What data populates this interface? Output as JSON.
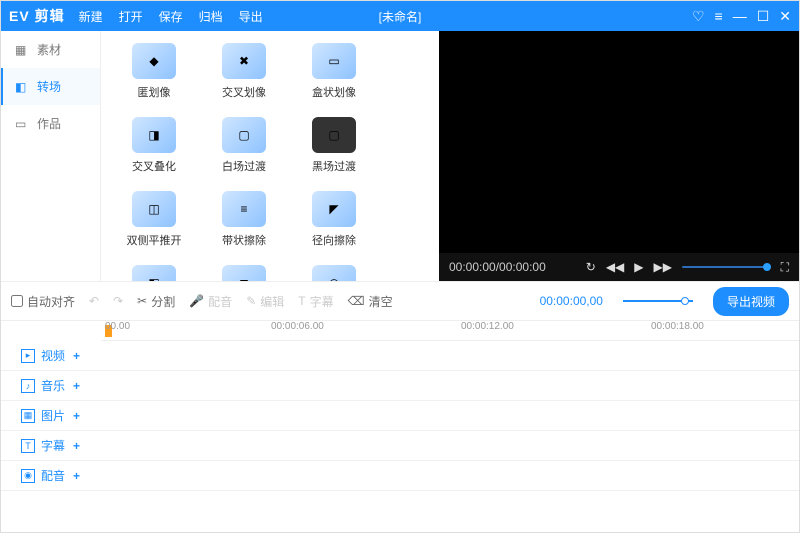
{
  "brand": "EV 剪辑",
  "menu": [
    "新建",
    "打开",
    "保存",
    "归档",
    "导出"
  ],
  "titleName": "[未命名]",
  "side": {
    "items": [
      "素材",
      "转场",
      "作品"
    ],
    "activeIndex": 1
  },
  "transitions": [
    "匿划像",
    "交叉划像",
    "盒状划像",
    "交叉叠化",
    "白场过渡",
    "黑场过渡",
    "双侧平推开",
    "带状擦除",
    "径向擦除",
    "",
    "",
    ""
  ],
  "preview": {
    "time": "00:00:00/00:00:00"
  },
  "toolbar": {
    "align": "自动对齐",
    "split": "分割",
    "dub": "配音",
    "edit": "编辑",
    "caption": "字幕",
    "clear": "清空",
    "timecode": "00:00:00,00",
    "export": "导出视频"
  },
  "ruler": [
    "00.00",
    "00:00:06.00",
    "00:00:12.00",
    "00:00:18.00"
  ],
  "tracks": [
    "视频",
    "音乐",
    "图片",
    "字幕",
    "配音"
  ]
}
